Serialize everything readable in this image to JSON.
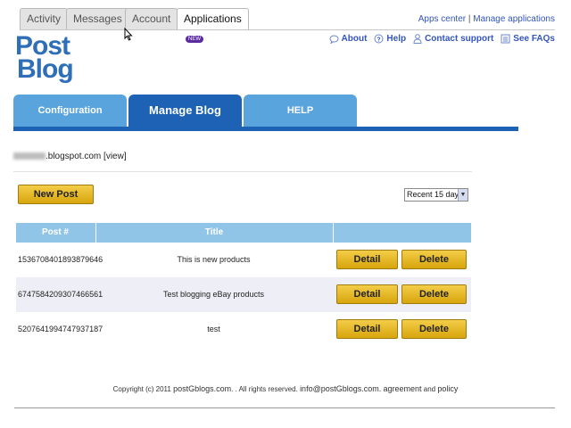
{
  "top_tabs": {
    "activity": "Activity",
    "messages": "Messages",
    "account": "Account",
    "applications": "Applications",
    "new_badge": "NEW"
  },
  "top_links": {
    "apps_center": "Apps center",
    "separator": "|",
    "manage_applications": "Manage applications"
  },
  "logo": {
    "line1": "Post",
    "line2": "Blog"
  },
  "help_links": {
    "about": "About",
    "help": "Help",
    "contact_support": "Contact support",
    "see_faqs": "See FAQs"
  },
  "blog_tabs": {
    "configuration": "Configuration",
    "manage_blog": "Manage Blog",
    "help": "HELP"
  },
  "blog": {
    "domain_suffix": ".blogspot.com",
    "view_label": "[view]"
  },
  "actions": {
    "new_post": "New Post",
    "period_selected": "Recent 15 day"
  },
  "table": {
    "headers": {
      "post_no": "Post #",
      "title": "Title",
      "actions": ""
    },
    "rows": [
      {
        "post_no": "1536708401893879646",
        "title": "This is new products",
        "detail": "Detail",
        "delete": "Delete"
      },
      {
        "post_no": "6747584209307466561",
        "title": "Test blogging eBay products",
        "detail": "Detail",
        "delete": "Delete"
      },
      {
        "post_no": "5207641994747937187",
        "title": "test",
        "detail": "Detail",
        "delete": "Delete"
      }
    ]
  },
  "footer": {
    "copyright": "Copyright (c) 2011",
    "site": "postGblogs.com",
    "rights": ". . All rights reserved.",
    "email": "info@postGblogs.com.",
    "agreement": "agreement",
    "and": "and",
    "policy": "policy"
  },
  "colors": {
    "brand_blue": "#1e62b6",
    "tab_light_blue": "#5aa4dd",
    "table_header": "#91c5e8",
    "button_gold": "#e8bb2a",
    "link_blue": "#3355bb",
    "new_badge": "#5b2ca0"
  }
}
